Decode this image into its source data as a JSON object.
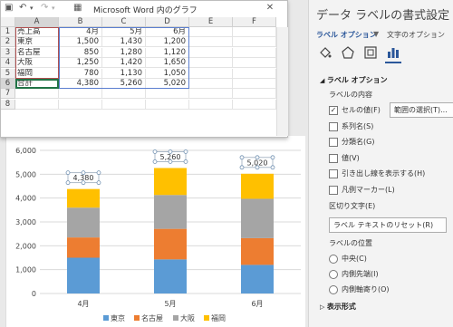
{
  "excel_window": {
    "title": "Microsoft Word 内のグラフ",
    "columns": [
      "A",
      "B",
      "C",
      "D",
      "E",
      "F"
    ],
    "rows": [
      "1",
      "2",
      "3",
      "4",
      "5",
      "6",
      "7",
      "8"
    ],
    "header_row": [
      "売上高",
      "4月",
      "5月",
      "6月"
    ],
    "data": [
      {
        "name": "東京",
        "v": [
          "1,500",
          "1,430",
          "1,200"
        ]
      },
      {
        "name": "名古屋",
        "v": [
          "850",
          "1,280",
          "1,120"
        ]
      },
      {
        "name": "大阪",
        "v": [
          "1,250",
          "1,420",
          "1,650"
        ]
      },
      {
        "name": "福岡",
        "v": [
          "780",
          "1,130",
          "1,050"
        ]
      },
      {
        "name": "合計",
        "v": [
          "4,380",
          "5,260",
          "5,020"
        ]
      }
    ]
  },
  "chart_data": {
    "type": "bar",
    "stacked": true,
    "categories": [
      "4月",
      "5月",
      "6月"
    ],
    "series": [
      {
        "name": "東京",
        "values": [
          1500,
          1430,
          1200
        ],
        "color": "#5b9bd5"
      },
      {
        "name": "名古屋",
        "values": [
          850,
          1280,
          1120
        ],
        "color": "#ed7d31"
      },
      {
        "name": "大阪",
        "values": [
          1250,
          1420,
          1650
        ],
        "color": "#a5a5a5"
      },
      {
        "name": "福岡",
        "values": [
          780,
          1130,
          1050
        ],
        "color": "#ffc000"
      }
    ],
    "data_labels": [
      "4,380",
      "5,260",
      "5,020"
    ],
    "yticks": [
      "0",
      "1,000",
      "2,000",
      "3,000",
      "4,000",
      "5,000",
      "6,000"
    ],
    "ylim": [
      0,
      6000
    ],
    "grid": true,
    "legend": "bottom"
  },
  "pane": {
    "title": "データ ラベルの書式設定",
    "tab_label_options": "ラベル オプション",
    "tab_text_options": "文字のオプション",
    "section_label_options": "ラベル オプション",
    "label_contents": "ラベルの内容",
    "checkboxes": [
      {
        "label": "セルの値(F)",
        "checked": true
      },
      {
        "label": "系列名(S)",
        "checked": false
      },
      {
        "label": "分類名(G)",
        "checked": false
      },
      {
        "label": "値(V)",
        "checked": false
      },
      {
        "label": "引き出し線を表示する(H)",
        "checked": false
      },
      {
        "label": "凡例マーカー(L)",
        "checked": false
      }
    ],
    "range_button": "範囲の選択(T)...",
    "separator_label": "区切り文字(E)",
    "reset_button": "ラベル テキストのリセット(R)",
    "label_position": "ラベルの位置",
    "radios": [
      {
        "label": "中央(C)",
        "selected": false
      },
      {
        "label": "内側先端(I)",
        "selected": false
      },
      {
        "label": "内側軸寄り(O)",
        "selected": false
      }
    ],
    "section_display": "表示形式"
  },
  "colors": {
    "accent": "#2b579a",
    "selection": "#217346"
  }
}
